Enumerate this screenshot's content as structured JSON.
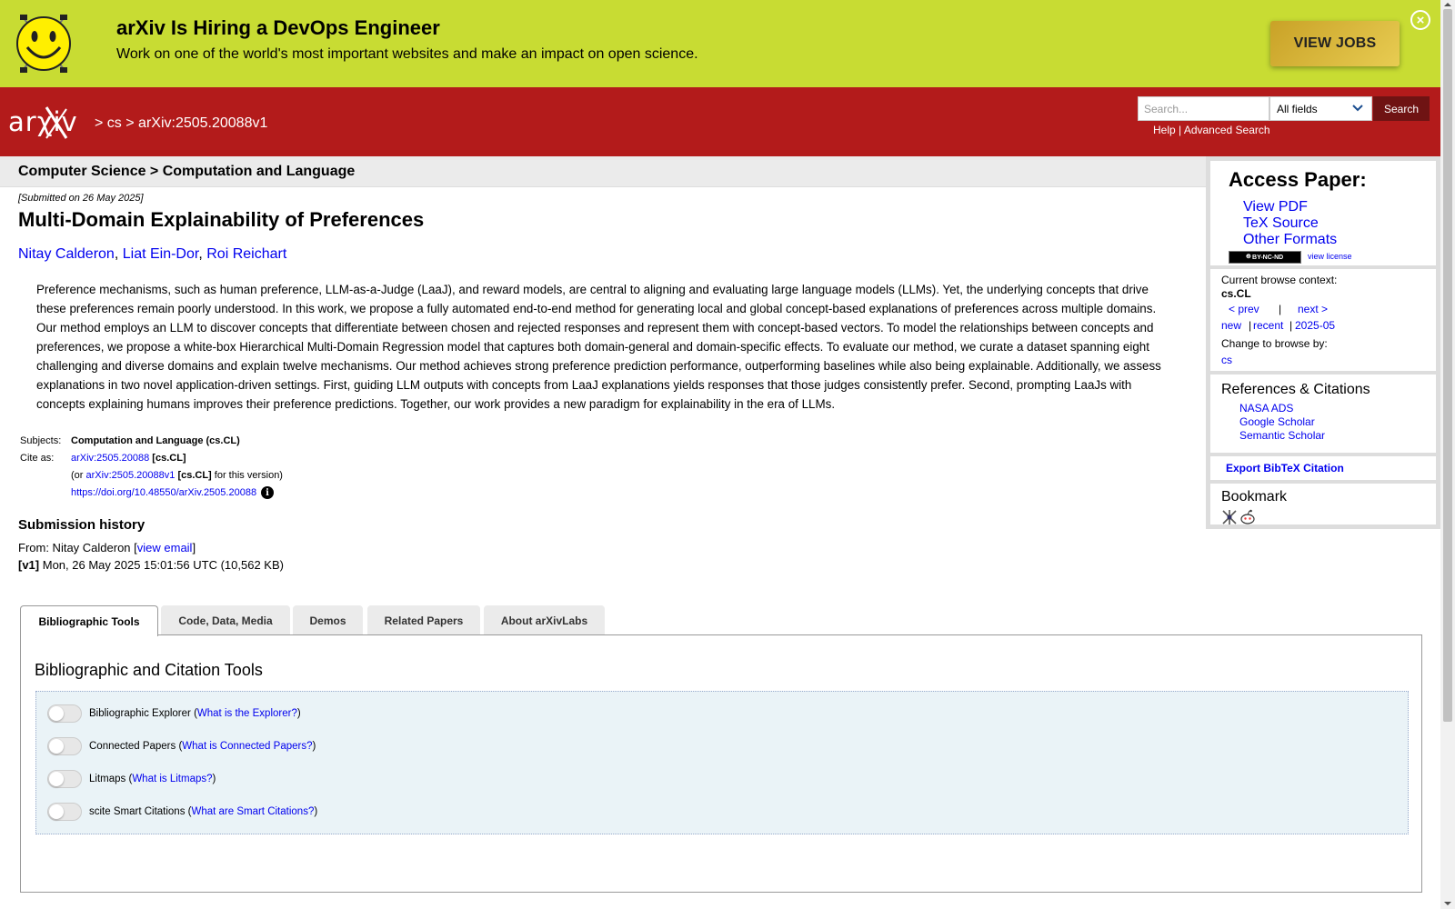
{
  "banner": {
    "title": "arXiv Is Hiring a DevOps Engineer",
    "text": "Work on one of the world's most important websites and make an impact on open science.",
    "button": "VIEW JOBS",
    "close_icon": "close-circle-icon",
    "background": "#c8dc33"
  },
  "header": {
    "logo": "arXiv",
    "crumb_sep1": ">",
    "crumb_cs": "cs",
    "crumb_sep2": ">",
    "crumb_id": "arXiv:2505.20088v1",
    "background": "#b31b1b",
    "search": {
      "placeholder": "Search...",
      "field": "All fields",
      "button": "Search",
      "help": "Help",
      "sep": "|",
      "advanced": "Advanced Search"
    }
  },
  "paper": {
    "subject_path": "Computer Science > Computation and Language",
    "submitted": "[Submitted on 26 May 2025]",
    "title": "Multi-Domain Explainability of Preferences",
    "authors": [
      "Nitay Calderon",
      "Liat Ein-Dor",
      "Roi Reichart"
    ],
    "author_sep": ",",
    "abstract": "Preference mechanisms, such as human preference, LLM-as-a-Judge (LaaJ), and reward models, are central to aligning and evaluating large language models (LLMs). Yet, the underlying concepts that drive these preferences remain poorly understood. In this work, we propose a fully automated end-to-end method for generating local and global concept-based explanations of preferences across multiple domains. Our method employs an LLM to discover concepts that differentiate between chosen and rejected responses and represent them with concept-based vectors. To model the relationships between concepts and preferences, we propose a white-box Hierarchical Multi-Domain Regression model that captures both domain-general and domain-specific effects. To evaluate our method, we curate a dataset spanning eight challenging and diverse domains and explain twelve mechanisms. Our method achieves strong preference prediction performance, outperforming baselines while also being explainable. Additionally, we assess explanations in two novel application-driven settings. First, guiding LLM outputs with concepts from LaaJ explanations yields responses that those judges consistently prefer. Second, prompting LaaJs with concepts explaining humans improves their preference predictions. Together, our work provides a new paradigm for explainability in the era of LLMs.",
    "subjects_label": "Subjects:",
    "subjects": "Computation and Language (cs.CL)",
    "cite_label": "Cite as:",
    "cite_id": "arXiv:2505.20088",
    "cite_tag": "[cs.CL]",
    "version_prefix": "(or",
    "version_id": "arXiv:2505.20088v1",
    "version_tag": "[cs.CL]",
    "version_suffix": "for this version)",
    "doi": "https://doi.org/10.48550/arXiv.2505.20088",
    "info_icon": "info-icon"
  },
  "history": {
    "heading": "Submission history",
    "from_prefix": "From: Nitay Calderon [",
    "view_email": "view email",
    "from_suffix": "]",
    "v1_label": "[v1]",
    "v1_text": "Mon, 26 May 2025 15:01:56 UTC (10,562 KB)"
  },
  "sidebar": {
    "access_heading": "Access Paper:",
    "links": [
      "View PDF",
      "TeX Source",
      "Other Formats"
    ],
    "license_badge": "BY-NC-ND",
    "view_license": "view license",
    "browse_context_label": "Current browse context:",
    "browse_context": "cs.CL",
    "prev": "< prev",
    "pipe": "|",
    "next": "next >",
    "new": "new",
    "recent": "recent",
    "month": "2025-05",
    "change_browse": "Change to browse by:",
    "cs": "cs",
    "refs_heading": "References & Citations",
    "refs": [
      "NASA ADS",
      "Google Scholar",
      "Semantic Scholar"
    ],
    "export_bibtex": "Export BibTeX Citation",
    "bookmark_heading": "Bookmark",
    "bookmark_icons": [
      "bibsonomy-icon",
      "reddit-icon"
    ]
  },
  "tabs": [
    "Bibliographic Tools",
    "Code, Data, Media",
    "Demos",
    "Related Papers",
    "About arXivLabs"
  ],
  "active_tab": "Bibliographic Tools",
  "panel": {
    "heading": "Bibliographic and Citation Tools",
    "tools": [
      {
        "label": "Bibliographic Explorer",
        "link": "What is the Explorer?"
      },
      {
        "label": "Connected Papers",
        "link": "What is Connected Papers?"
      },
      {
        "label": "Litmaps",
        "link": "What is Litmaps?"
      },
      {
        "label": "scite Smart Citations",
        "link": "What are Smart Citations?"
      }
    ]
  }
}
